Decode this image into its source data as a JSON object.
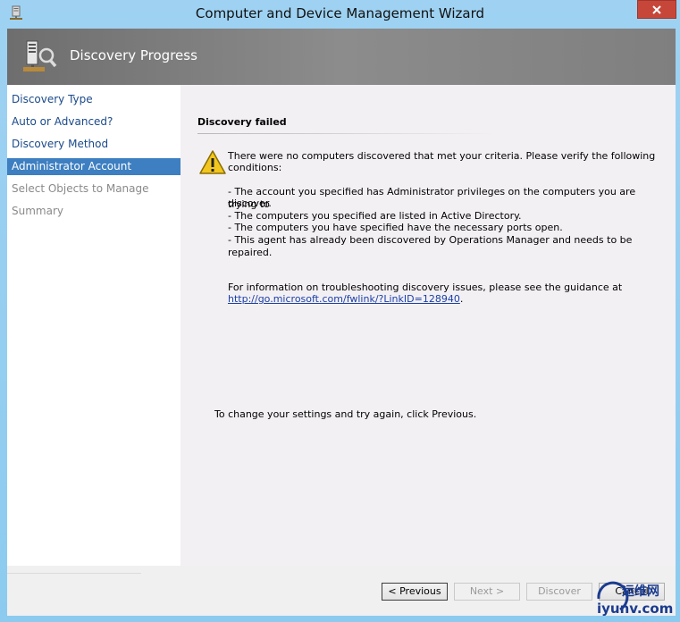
{
  "window": {
    "title": "Computer and Device Management Wizard"
  },
  "header": {
    "title": "Discovery Progress"
  },
  "sidebar": {
    "items": [
      {
        "label": "Discovery Type",
        "state": "normal"
      },
      {
        "label": "Auto or Advanced?",
        "state": "normal"
      },
      {
        "label": "Discovery Method",
        "state": "normal"
      },
      {
        "label": "Administrator Account",
        "state": "active"
      },
      {
        "label": "Select Objects to Manage",
        "state": "disabled"
      },
      {
        "label": "Summary",
        "state": "disabled"
      }
    ]
  },
  "main": {
    "section_title": "Discovery failed",
    "message_intro_1": "There were no computers discovered that met your criteria.  Please verify the following",
    "message_intro_2": "conditions:",
    "conditions": [
      "- The account you specified has Administrator privileges on the computers you are trying to",
      "discover.",
      "- The computers you specified are listed in Active Directory.",
      "- The computers you have specified have the necessary ports open.",
      "- This agent has already been discovered by Operations Manager and needs to be repaired."
    ],
    "info_text": "For information on troubleshooting discovery issues, please see the guidance at",
    "info_link": "http://go.microsoft.com/fwlink/?LinkID=128940",
    "info_suffix": ".",
    "retry_text": "To change your settings and try again, click Previous."
  },
  "footer": {
    "previous_label": "< Previous",
    "next_label": "Next >",
    "discover_label": "Discover",
    "cancel_label": "Cancel"
  },
  "watermark": {
    "line1": "运维网",
    "line2": "iyunv.com"
  },
  "colors": {
    "accent": "#3d7fc1",
    "link": "#1a3fa6",
    "close": "#c7463a"
  }
}
